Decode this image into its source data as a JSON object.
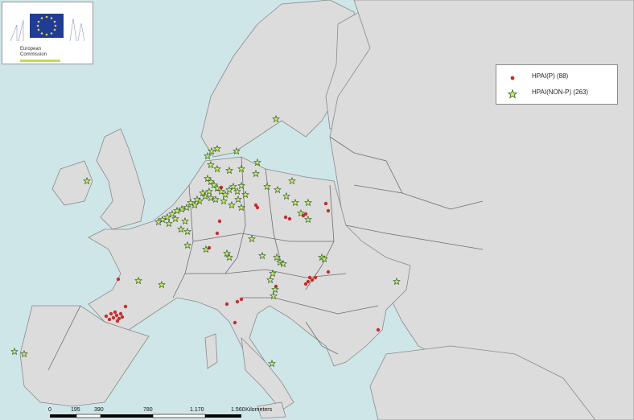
{
  "logo": {
    "line1": "European",
    "line2": "Commission"
  },
  "legend": {
    "items": [
      {
        "label": "HPAI(P) (88)",
        "color": "#c43030"
      },
      {
        "label": "HPAI(NON-P) (263)",
        "color": "#c8ec6a"
      }
    ]
  },
  "scale": {
    "ticks": [
      "0",
      "195",
      "390",
      "780",
      "1.170",
      "1.560"
    ],
    "unit": "Kilometers"
  },
  "colors": {
    "sea": "#cfe6e8",
    "land": "#dcdcdc",
    "border": "#6e6e6e",
    "point_red": "#c43030",
    "point_green": "#c8ec6a"
  }
}
